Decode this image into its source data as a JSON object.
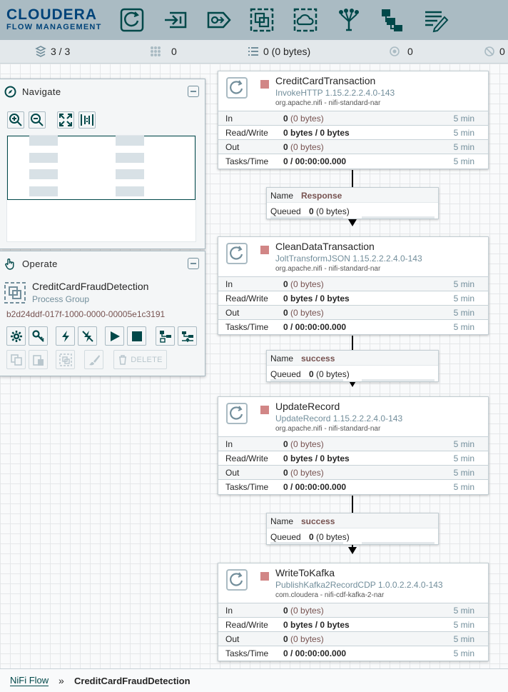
{
  "header": {
    "brand": "CLOUDERA",
    "subtitle": "FLOW MANAGEMENT",
    "tools": [
      "processor-icon",
      "input-port-icon",
      "output-port-icon",
      "process-group-icon",
      "remote-process-group-icon",
      "funnel-icon",
      "template-icon",
      "label-icon"
    ]
  },
  "status": {
    "cluster": "3 / 3",
    "threads": "0",
    "queued": "0 (0 bytes)",
    "transmitting": "0",
    "not_transmitting": "0"
  },
  "navigate": {
    "title": "Navigate"
  },
  "operate": {
    "title": "Operate",
    "component_name": "CreditCardFraudDetection",
    "component_type": "Process Group",
    "component_id": "b2d24ddf-017f-1000-0000-00005e1c3191",
    "delete_label": "DELETE"
  },
  "processors": [
    {
      "name": "CreditCardTransaction",
      "type": "InvokeHTTP 1.15.2.2.2.4.0-143",
      "bundle": "org.apache.nifi - nifi-standard-nar",
      "in_label": "In",
      "in_val": "0",
      "in_bytes": "(0 bytes)",
      "in_time": "5 min",
      "rw_label": "Read/Write",
      "rw_val": "0 bytes / 0 bytes",
      "rw_time": "5 min",
      "out_label": "Out",
      "out_val": "0",
      "out_bytes": "(0 bytes)",
      "out_time": "5 min",
      "tasks_label": "Tasks/Time",
      "tasks_val": "0 / 00:00:00.000",
      "tasks_time": "5 min"
    },
    {
      "name": "CleanDataTransaction",
      "type": "JoltTransformJSON 1.15.2.2.2.4.0-143",
      "bundle": "org.apache.nifi - nifi-standard-nar",
      "in_label": "In",
      "in_val": "0",
      "in_bytes": "(0 bytes)",
      "in_time": "5 min",
      "rw_label": "Read/Write",
      "rw_val": "0 bytes / 0 bytes",
      "rw_time": "5 min",
      "out_label": "Out",
      "out_val": "0",
      "out_bytes": "(0 bytes)",
      "out_time": "5 min",
      "tasks_label": "Tasks/Time",
      "tasks_val": "0 / 00:00:00.000",
      "tasks_time": "5 min"
    },
    {
      "name": "UpdateRecord",
      "type": "UpdateRecord 1.15.2.2.2.4.0-143",
      "bundle": "org.apache.nifi - nifi-standard-nar",
      "in_label": "In",
      "in_val": "0",
      "in_bytes": "(0 bytes)",
      "in_time": "5 min",
      "rw_label": "Read/Write",
      "rw_val": "0 bytes / 0 bytes",
      "rw_time": "5 min",
      "out_label": "Out",
      "out_val": "0",
      "out_bytes": "(0 bytes)",
      "out_time": "5 min",
      "tasks_label": "Tasks/Time",
      "tasks_val": "0 / 00:00:00.000",
      "tasks_time": "5 min"
    },
    {
      "name": "WriteToKafka",
      "type": "PublishKafka2RecordCDP 1.0.0.2.2.4.0-143",
      "bundle": "com.cloudera - nifi-cdf-kafka-2-nar",
      "in_label": "In",
      "in_val": "0",
      "in_bytes": "(0 bytes)",
      "in_time": "5 min",
      "rw_label": "Read/Write",
      "rw_val": "0 bytes / 0 bytes",
      "rw_time": "5 min",
      "out_label": "Out",
      "out_val": "0",
      "out_bytes": "(0 bytes)",
      "out_time": "5 min",
      "tasks_label": "Tasks/Time",
      "tasks_val": "0 / 00:00:00.000",
      "tasks_time": "5 min"
    }
  ],
  "connections": [
    {
      "name_label": "Name",
      "name": "Response",
      "queued_label": "Queued",
      "queued_count": "0",
      "queued_bytes": "(0 bytes)"
    },
    {
      "name_label": "Name",
      "name": "success",
      "queued_label": "Queued",
      "queued_count": "0",
      "queued_bytes": "(0 bytes)"
    },
    {
      "name_label": "Name",
      "name": "success",
      "queued_label": "Queued",
      "queued_count": "0",
      "queued_bytes": "(0 bytes)"
    }
  ],
  "breadcrumb": {
    "root": "NiFi Flow",
    "separator": "»",
    "current": "CreditCardFraudDetection"
  },
  "colors": {
    "header_bg": "#aabbc3",
    "brand": "#004379",
    "stopped": "#d18686",
    "value_text": "#775351",
    "accent": "#004849"
  }
}
